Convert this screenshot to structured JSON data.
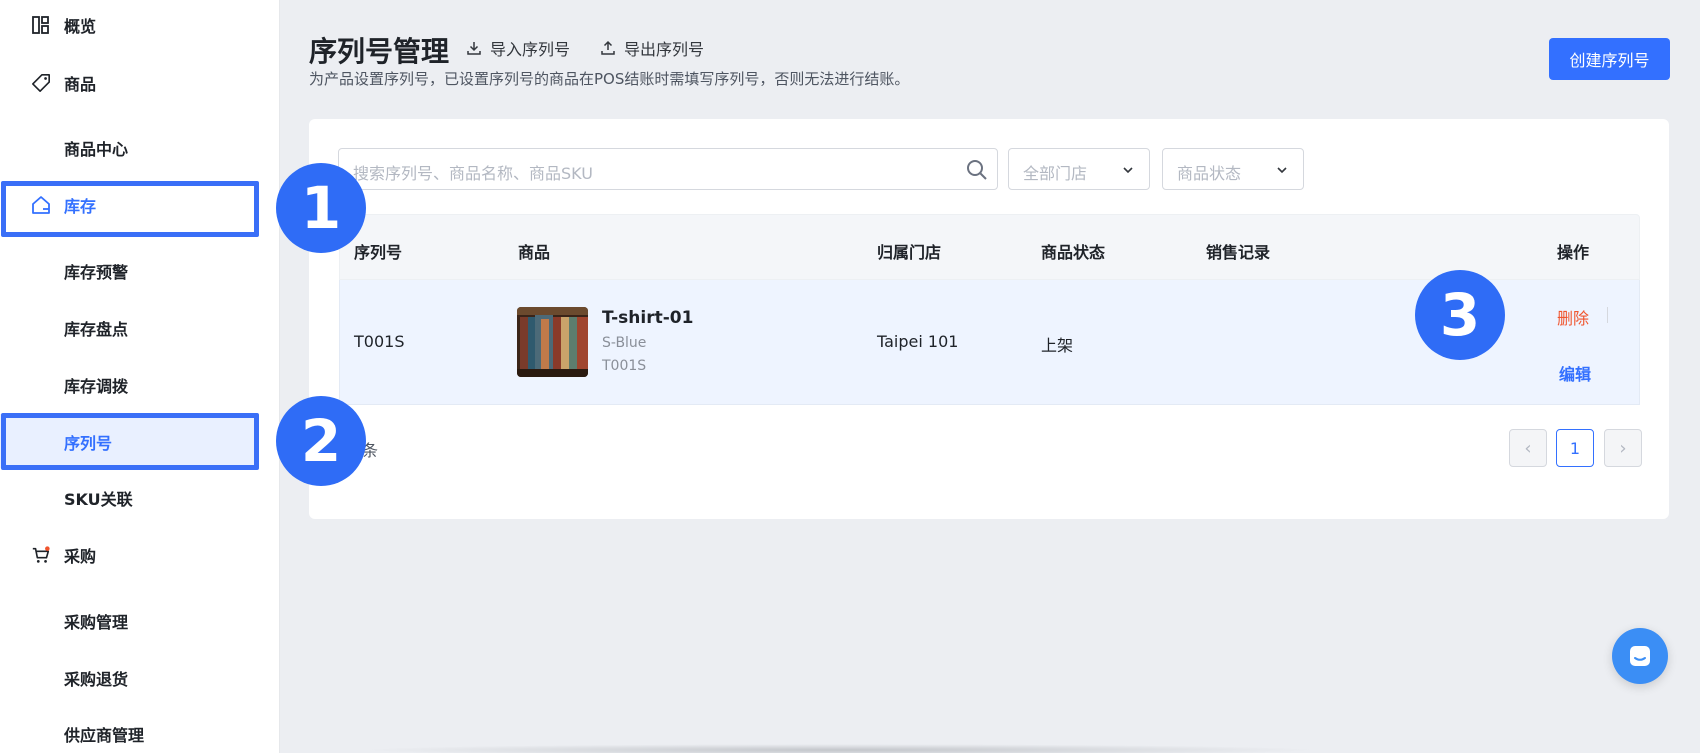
{
  "sidebar": {
    "items": [
      {
        "label": "概览",
        "icon": "dashboard-icon"
      },
      {
        "label": "商品",
        "icon": "tag-icon"
      },
      {
        "label": "商品中心"
      },
      {
        "label": "库存",
        "icon": "warehouse-icon"
      },
      {
        "label": "库存预警"
      },
      {
        "label": "库存盘点"
      },
      {
        "label": "库存调拨"
      },
      {
        "label": "序列号"
      },
      {
        "label": "SKU关联"
      },
      {
        "label": "采购",
        "icon": "cart-icon"
      },
      {
        "label": "采购管理"
      },
      {
        "label": "采购退货"
      },
      {
        "label": "供应商管理"
      }
    ]
  },
  "annotations": [
    "1",
    "2",
    "3"
  ],
  "header": {
    "title": "序列号管理",
    "import_label": "导入序列号",
    "export_label": "导出序列号",
    "description": "为产品设置序列号，已设置序列号的商品在POS结账时需填写序列号，否则无法进行结账。",
    "create_label": "创建序列号"
  },
  "filters": {
    "search_placeholder": "搜索序列号、商品名称、商品SKU",
    "store_placeholder": "全部门店",
    "status_placeholder": "商品状态"
  },
  "table": {
    "columns": [
      "序列号",
      "商品",
      "归属门店",
      "商品状态",
      "销售记录",
      "操作"
    ],
    "rows": [
      {
        "serial": "T001S",
        "product_name": "T-shirt-01",
        "variant": "S-Blue",
        "sku": "T001S",
        "store": "Taipei 101",
        "status": "上架",
        "sales": "",
        "delete_label": "删除",
        "edit_label": "编辑"
      }
    ]
  },
  "pagination": {
    "total_text": "条",
    "current_page": "1",
    "prev": "‹",
    "next": "›"
  },
  "colors": {
    "accent": "#3370ff",
    "badge": "#2f6cf6",
    "danger": "#f0542d"
  }
}
